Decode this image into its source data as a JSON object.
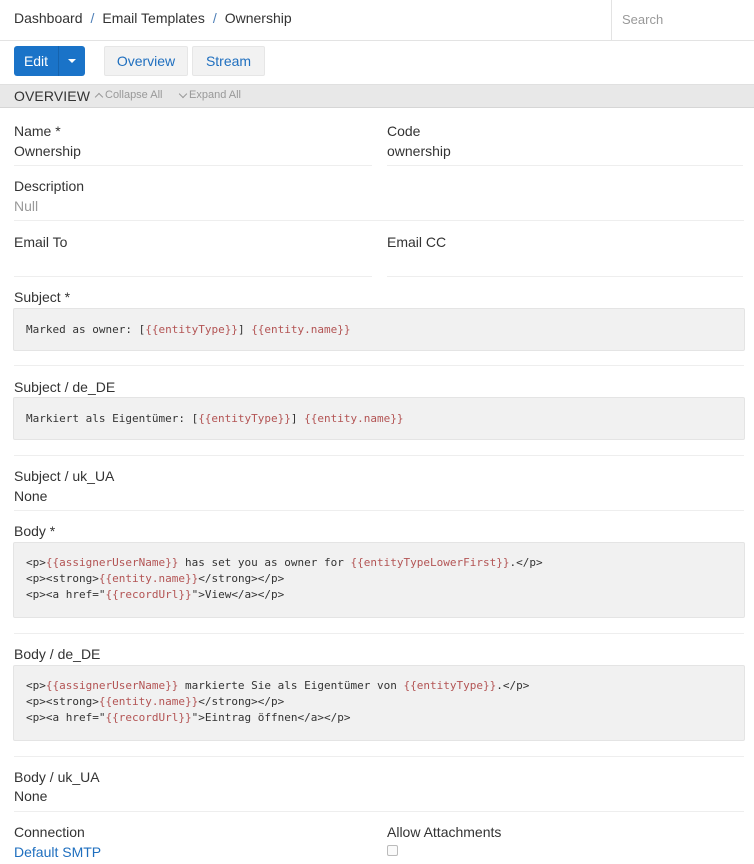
{
  "breadcrumb": {
    "items": [
      "Dashboard",
      "Email Templates",
      "Ownership"
    ],
    "separator": "/"
  },
  "search": {
    "placeholder": "Search",
    "value": ""
  },
  "toolbar": {
    "edit_label": "Edit",
    "overview_label": "Overview",
    "stream_label": "Stream"
  },
  "panel": {
    "title": "OVERVIEW",
    "collapse_label": "Collapse All",
    "expand_label": "Expand All"
  },
  "fields": {
    "name": {
      "label": "Name *",
      "value": "Ownership"
    },
    "code": {
      "label": "Code",
      "value": "ownership"
    },
    "description": {
      "label": "Description",
      "value": "Null"
    },
    "email_to": {
      "label": "Email To",
      "value": ""
    },
    "email_cc": {
      "label": "Email CC",
      "value": ""
    },
    "subject": {
      "label": "Subject *",
      "prefix": "Marked as owner: [",
      "var1": "{{entityType}}",
      "mid": "] ",
      "var2": "{{entity.name}}",
      "suffix": "}}"
    },
    "subject_de": {
      "label": "Subject / de_DE",
      "prefix": "Markiert als Eigentümer: [",
      "var1": "{{entityType}}",
      "mid": "] ",
      "var2": "{{entity.name}}",
      "suffix": "}}"
    },
    "subject_uk": {
      "label": "Subject / uk_UA",
      "value": "None"
    },
    "body": {
      "label": "Body *",
      "l1_a": "<p>",
      "l1_var1": "{{assignerUserName}}",
      "l1_mid": " has set you as owner for ",
      "l1_var2": "{{entityTypeLowerFirst}}",
      "l1_end": ".</p>",
      "l2_a": "<p><strong>",
      "l2_var": "{{entity.name}}",
      "l2_end": "</strong></p>",
      "l3_a": "<p><a href=\"",
      "l3_var": "{{recordUrl}}",
      "l3_end": "\">View</a></p>"
    },
    "body_de": {
      "label": "Body / de_DE",
      "l1_a": "<p>",
      "l1_var1": "{{assignerUserName}}",
      "l1_mid": " markierte Sie als Eigentümer von ",
      "l1_var2": "{{entityType}}",
      "l1_end": ".</p>",
      "l2_a": "<p><strong>",
      "l2_var": "{{entity.name}}",
      "l2_end": "</strong></p>",
      "l3_a": "<p><a href=\"",
      "l3_var": "{{recordUrl}}",
      "l3_end": "\">Eintrag öffnen</a></p>"
    },
    "body_uk": {
      "label": "Body / uk_UA",
      "value": "None"
    },
    "connection": {
      "label": "Connection",
      "value": "Default SMTP"
    },
    "allow_attachments": {
      "label": "Allow Attachments",
      "checked": false
    }
  }
}
